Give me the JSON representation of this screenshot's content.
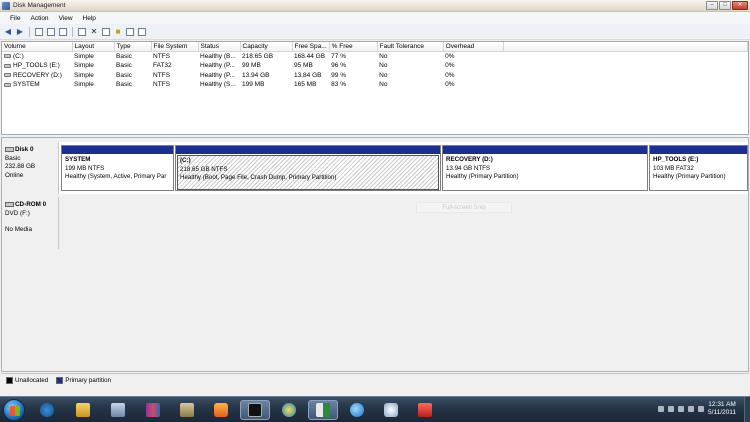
{
  "window": {
    "title": "Disk Management"
  },
  "menu": [
    "File",
    "Action",
    "View",
    "Help"
  ],
  "volume_table": {
    "headers": [
      "Volume",
      "Layout",
      "Type",
      "File System",
      "Status",
      "Capacity",
      "Free Spa...",
      "% Free",
      "Fault Tolerance",
      "Overhead"
    ],
    "rows": [
      [
        "(C:)",
        "Simple",
        "Basic",
        "NTFS",
        "Healthy (B...",
        "218.65 GB",
        "168.44 GB",
        "77 %",
        "No",
        "0%"
      ],
      [
        "HP_TOOLS (E:)",
        "Simple",
        "Basic",
        "FAT32",
        "Healthy (P...",
        "99 MB",
        "95 MB",
        "96 %",
        "No",
        "0%"
      ],
      [
        "RECOVERY (D:)",
        "Simple",
        "Basic",
        "NTFS",
        "Healthy (P...",
        "13.94 GB",
        "13.84 GB",
        "99 %",
        "No",
        "0%"
      ],
      [
        "SYSTEM",
        "Simple",
        "Basic",
        "NTFS",
        "Healthy (S...",
        "199 MB",
        "165 MB",
        "83 %",
        "No",
        "0%"
      ]
    ]
  },
  "disk0": {
    "name": "Disk 0",
    "type": "Basic",
    "size": "232.88 GB",
    "status": "Online",
    "partitions": [
      {
        "name": "SYSTEM",
        "size": "199 MB NTFS",
        "status": "Healthy (System, Active, Primary Par"
      },
      {
        "name": "(C:)",
        "size": "218.65 GB NTFS",
        "status": "Healthy (Boot, Page File, Crash Dump, Primary Partition)"
      },
      {
        "name": "RECOVERY  (D:)",
        "size": "13.94 GB NTFS",
        "status": "Healthy (Primary Partition)"
      },
      {
        "name": "HP_TOOLS  (E:)",
        "size": "103 MB FAT32",
        "status": "Healthy (Primary Partition)"
      }
    ]
  },
  "cdrom0": {
    "name": "CD-ROM 0",
    "type": "DVD (F:)",
    "media": "No Media"
  },
  "ghost_tooltip": "Full-screen Snip",
  "legend": [
    {
      "label": "Unallocated",
      "color": "#000000"
    },
    {
      "label": "Primary partition",
      "color": "#1c2f8f"
    }
  ],
  "clock": {
    "time": "12:31 AM",
    "date": "5/11/2011"
  }
}
